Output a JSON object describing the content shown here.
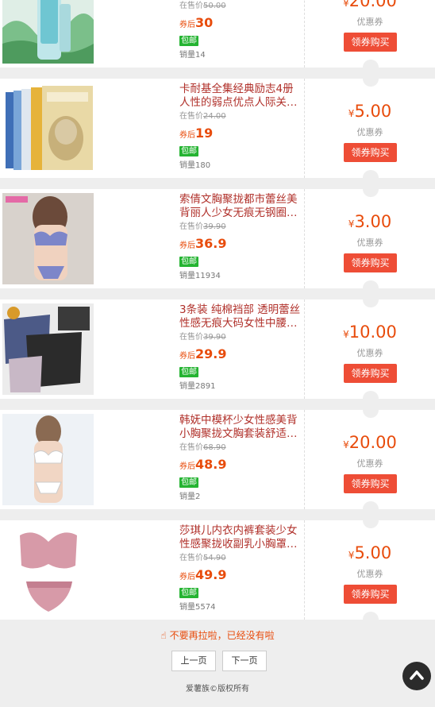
{
  "products": [
    {
      "title": "",
      "orig_label": "在售价",
      "orig_price": "50.00",
      "after_label": "券后",
      "after_price": "30",
      "ship_label": "包邮",
      "sales_label": "销量",
      "sales": "14",
      "coupon_symbol": "¥",
      "coupon_value": "20.00",
      "coupon_label": "优惠券",
      "button_label": "领券购买",
      "image": "green-bottle-product-photo"
    },
    {
      "title": "卡耐基全集经典励志4册人性的弱点优点人际关系学…",
      "orig_label": "在售价",
      "orig_price": "24.00",
      "after_label": "券后",
      "after_price": "19",
      "ship_label": "包邮",
      "sales_label": "销量",
      "sales": "180",
      "coupon_symbol": "¥",
      "coupon_value": "5.00",
      "coupon_label": "优惠券",
      "button_label": "领券购买",
      "image": "book-set-photo"
    },
    {
      "title": "索倩文胸聚拢都市蕾丝美背丽人少女无痕无钢圈内…",
      "orig_label": "在售价",
      "orig_price": "39.90",
      "after_label": "券后",
      "after_price": "36.9",
      "ship_label": "包邮",
      "sales_label": "销量",
      "sales": "11934",
      "coupon_symbol": "¥",
      "coupon_value": "3.00",
      "coupon_label": "优惠券",
      "button_label": "领券购买",
      "image": "lingerie-model-photo"
    },
    {
      "title": "3条装 纯棉裆部 透明蕾丝性感无痕大码女性中腰女…",
      "orig_label": "在售价",
      "orig_price": "39.90",
      "after_label": "券后",
      "after_price": "29.9",
      "ship_label": "包邮",
      "sales_label": "销量",
      "sales": "2891",
      "coupon_symbol": "¥",
      "coupon_value": "10.00",
      "coupon_label": "优惠券",
      "button_label": "领券购买",
      "image": "lace-underwear-photo"
    },
    {
      "title": "韩妩中模杯少女性感美背小胸聚拢文胸套装舒适无…",
      "orig_label": "在售价",
      "orig_price": "68.90",
      "after_label": "券后",
      "after_price": "48.9",
      "ship_label": "包邮",
      "sales_label": "销量",
      "sales": "2",
      "coupon_symbol": "¥",
      "coupon_value": "20.00",
      "coupon_label": "优惠券",
      "button_label": "领券购买",
      "image": "white-lingerie-model-photo"
    },
    {
      "title": "莎琪儿内衣内裤套装少女性感聚拢收副乳小胸罩加…",
      "orig_label": "在售价",
      "orig_price": "54.90",
      "after_label": "券后",
      "after_price": "49.9",
      "ship_label": "包邮",
      "sales_label": "销量",
      "sales": "5574",
      "coupon_symbol": "¥",
      "coupon_value": "5.00",
      "coupon_label": "优惠券",
      "button_label": "领券购买",
      "image": "pink-lace-set-photo"
    }
  ],
  "footer": {
    "message": "不要再拉啦，已经没有啦",
    "prev_label": "上一页",
    "next_label": "下一页",
    "copyright": "爱薯族©版权所有"
  },
  "icons": {
    "hand": "pointing-hand-icon",
    "to_top": "arrow-up-icon"
  },
  "colors": {
    "accent": "#ee4d36",
    "price": "#e84c0c",
    "title": "#b0302a",
    "free_ship": "#25b432",
    "background": "#eeeeee"
  }
}
